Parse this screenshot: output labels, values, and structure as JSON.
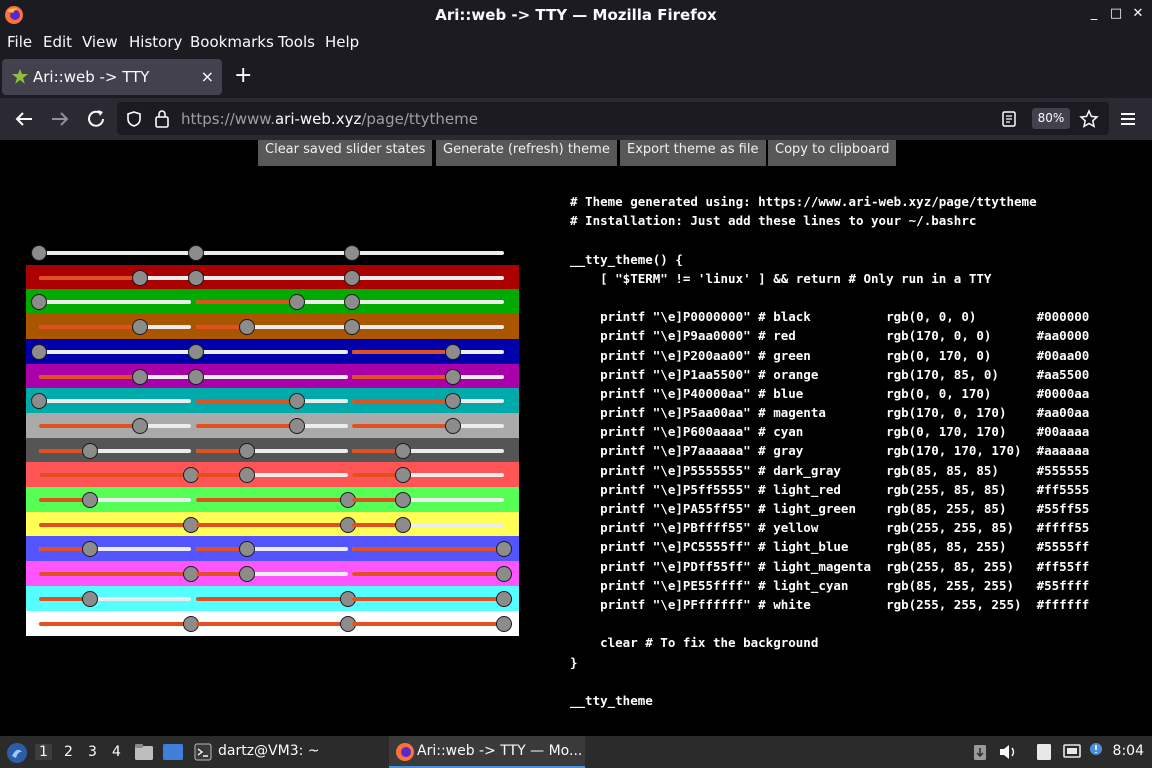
{
  "window": {
    "title": "Ari::web -> TTY — Mozilla Firefox",
    "controls": [
      "_",
      "□",
      "✕"
    ]
  },
  "menu": [
    "File",
    "Edit",
    "View",
    "History",
    "Bookmarks",
    "Tools",
    "Help"
  ],
  "tab": {
    "title": "Ari::web -> TTY",
    "close": "×",
    "new_tab": "+"
  },
  "nav": {
    "url_prefix": "https://www.",
    "url_host": "ari-web.xyz",
    "url_path": "/page/ttytheme",
    "zoom": "80%"
  },
  "buttons": {
    "clear": "Clear saved slider states",
    "generate": "Generate (refresh) theme",
    "export": "Export theme as file",
    "copy": "Copy to clipboard"
  },
  "slider_rows": [
    {
      "name": "black",
      "bg": "#000000",
      "values": [
        0,
        0,
        0
      ]
    },
    {
      "name": "red",
      "bg": "#aa0000",
      "values": [
        170,
        0,
        0
      ]
    },
    {
      "name": "green",
      "bg": "#00aa00",
      "values": [
        0,
        170,
        0
      ]
    },
    {
      "name": "orange",
      "bg": "#aa5500",
      "values": [
        170,
        85,
        0
      ]
    },
    {
      "name": "blue",
      "bg": "#0000aa",
      "values": [
        0,
        0,
        170
      ]
    },
    {
      "name": "magenta",
      "bg": "#aa00aa",
      "values": [
        170,
        0,
        170
      ]
    },
    {
      "name": "cyan",
      "bg": "#00aaaa",
      "values": [
        0,
        170,
        170
      ]
    },
    {
      "name": "gray",
      "bg": "#aaaaaa",
      "values": [
        170,
        170,
        170
      ]
    },
    {
      "name": "dark_gray",
      "bg": "#555555",
      "values": [
        85,
        85,
        85
      ]
    },
    {
      "name": "light_red",
      "bg": "#ff5555",
      "values": [
        255,
        85,
        85
      ]
    },
    {
      "name": "light_green",
      "bg": "#55ff55",
      "values": [
        85,
        255,
        85
      ]
    },
    {
      "name": "yellow",
      "bg": "#ffff55",
      "values": [
        255,
        255,
        85
      ]
    },
    {
      "name": "light_blue",
      "bg": "#5555ff",
      "values": [
        85,
        85,
        255
      ]
    },
    {
      "name": "light_magenta",
      "bg": "#ff55ff",
      "values": [
        255,
        85,
        255
      ]
    },
    {
      "name": "light_cyan",
      "bg": "#55ffff",
      "values": [
        85,
        255,
        255
      ]
    },
    {
      "name": "white",
      "bg": "#ffffff",
      "values": [
        255,
        255,
        255
      ]
    }
  ],
  "code_lines": [
    "# Theme generated using: https://www.ari-web.xyz/page/ttytheme",
    "# Installation: Just add these lines to your ~/.bashrc",
    "",
    "__tty_theme() {",
    "    [ \"$TERM\" != 'linux' ] && return # Only run in a TTY",
    "",
    "    printf \"\\e]P0000000\" # black          rgb(0, 0, 0)        #000000",
    "    printf \"\\e]P9aa0000\" # red            rgb(170, 0, 0)      #aa0000",
    "    printf \"\\e]P200aa00\" # green          rgb(0, 170, 0)      #00aa00",
    "    printf \"\\e]P1aa5500\" # orange         rgb(170, 85, 0)     #aa5500",
    "    printf \"\\e]P40000aa\" # blue           rgb(0, 0, 170)      #0000aa",
    "    printf \"\\e]P5aa00aa\" # magenta        rgb(170, 0, 170)    #aa00aa",
    "    printf \"\\e]P600aaaa\" # cyan           rgb(0, 170, 170)    #00aaaa",
    "    printf \"\\e]P7aaaaaa\" # gray           rgb(170, 170, 170)  #aaaaaa",
    "    printf \"\\e]P5555555\" # dark_gray      rgb(85, 85, 85)     #555555",
    "    printf \"\\e]P5ff5555\" # light_red      rgb(255, 85, 85)    #ff5555",
    "    printf \"\\e]PA55ff55\" # light_green    rgb(85, 255, 85)    #55ff55",
    "    printf \"\\e]PBffff55\" # yellow         rgb(255, 255, 85)   #ffff55",
    "    printf \"\\e]PC5555ff\" # light_blue     rgb(85, 85, 255)    #5555ff",
    "    printf \"\\e]PDff55ff\" # light_magenta  rgb(255, 85, 255)   #ff55ff",
    "    printf \"\\e]PE55ffff\" # light_cyan     rgb(85, 255, 255)   #55ffff",
    "    printf \"\\e]PFffffff\" # white          rgb(255, 255, 255)  #ffffff",
    "",
    "    clear # To fix the background",
    "}",
    "",
    "__tty_theme"
  ],
  "taskbar": {
    "workspaces": [
      "1",
      "2",
      "3",
      "4"
    ],
    "terminal": "dartz@VM3: ~",
    "browser": "Ari::web -> TTY — Mo...",
    "clock": "8:04"
  },
  "colors": {
    "accent_fill": "#e05020",
    "track": "#ececec",
    "button_bg": "#585858"
  }
}
